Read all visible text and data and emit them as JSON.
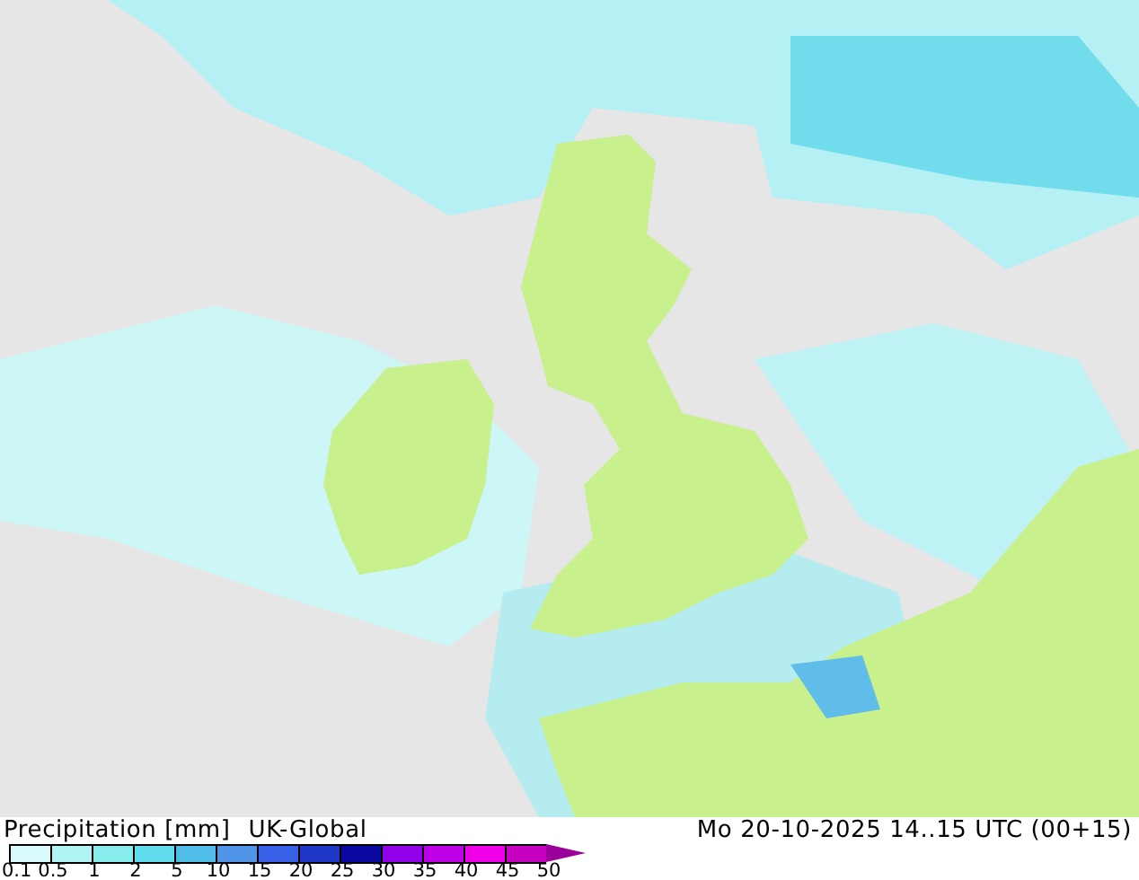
{
  "title": "Precipitation [mm]",
  "model": "UK-Global",
  "valid_time": "Mo 20-10-2025 14..15 UTC (00+15)",
  "legend": {
    "swatches": [
      {
        "color": "#d8fafa"
      },
      {
        "color": "#b0f4f4"
      },
      {
        "color": "#88ecec"
      },
      {
        "color": "#60dcec"
      },
      {
        "color": "#50bce8"
      },
      {
        "color": "#5094e8"
      },
      {
        "color": "#3860e8"
      },
      {
        "color": "#2038c8"
      },
      {
        "color": "#0808a0"
      },
      {
        "color": "#9000e8"
      },
      {
        "color": "#c000e8"
      },
      {
        "color": "#f000e8"
      },
      {
        "color": "#c800c0"
      }
    ],
    "labels": [
      "0.1",
      "0.5",
      "1",
      "2",
      "5",
      "10",
      "15",
      "20",
      "25",
      "30",
      "35",
      "40",
      "45",
      "50"
    ]
  }
}
